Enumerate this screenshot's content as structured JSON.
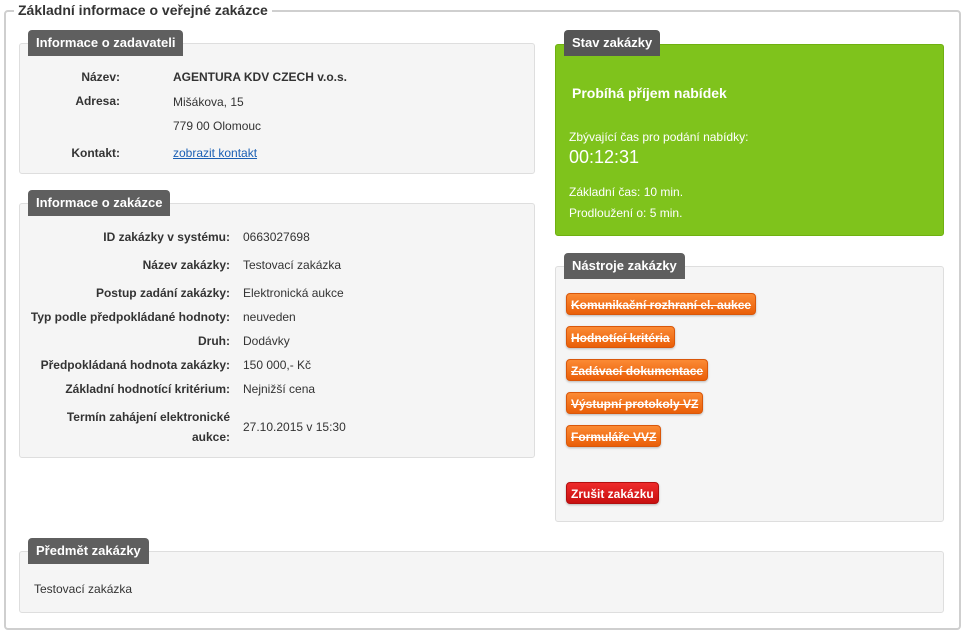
{
  "page": {
    "legend": "Základní informace o veřejné zakázce"
  },
  "contracting": {
    "title": "Informace o zadavateli",
    "name_label": "Název:",
    "name_value": "AGENTURA KDV CZECH v.o.s.",
    "address_label": "Adresa:",
    "address_line1": "Mišákova, 15",
    "address_line2": "779 00 Olomouc",
    "contact_label": "Kontakt:",
    "contact_link": "zobrazit kontakt"
  },
  "tender": {
    "title": "Informace o zakázce",
    "rows": [
      {
        "label": "ID zakázky v systému:",
        "value": "0663027698"
      },
      {
        "label": "Název zakázky:",
        "value": "Testovací zakázka"
      },
      {
        "label": "Postup zadání zakázky:",
        "value": "Elektronická aukce"
      },
      {
        "label": "Typ podle předpokládané hodnoty:",
        "value": "neuveden"
      },
      {
        "label": "Druh:",
        "value": "Dodávky"
      },
      {
        "label": "Předpokládaná hodnota zakázky:",
        "value": "150 000,- Kč"
      },
      {
        "label": "Základní hodnotící kritérium:",
        "value": "Nejnižší cena"
      },
      {
        "label_line1": "Termín zahájení elektronické",
        "label_line2": "aukce:",
        "value": "27.10.2015 v 15:30"
      }
    ]
  },
  "status": {
    "title": "Stav zakázky",
    "state": "Probíhá příjem nabídek",
    "remaining_label": "Zbývající čas pro podání nabídky:",
    "remaining_time": "00:12:31",
    "base_time": "Základní čas: 10 min.",
    "extension": "Prodloužení o: 5 min.",
    "color": "#7fc31c"
  },
  "tools": {
    "title": "Nástroje zakázky",
    "buttons": [
      "Komunikační rozhraní el. aukce",
      "Hodnotící kritéria",
      "Zadávací dokumentace",
      "Výstupní protokoly VZ",
      "Formuláře VVZ"
    ],
    "cancel": "Zrušit zakázku",
    "button_color": "#f07318",
    "cancel_color": "#d91a1a"
  },
  "subject": {
    "title": "Předmět zakázky",
    "text": "Testovací zakázka"
  }
}
